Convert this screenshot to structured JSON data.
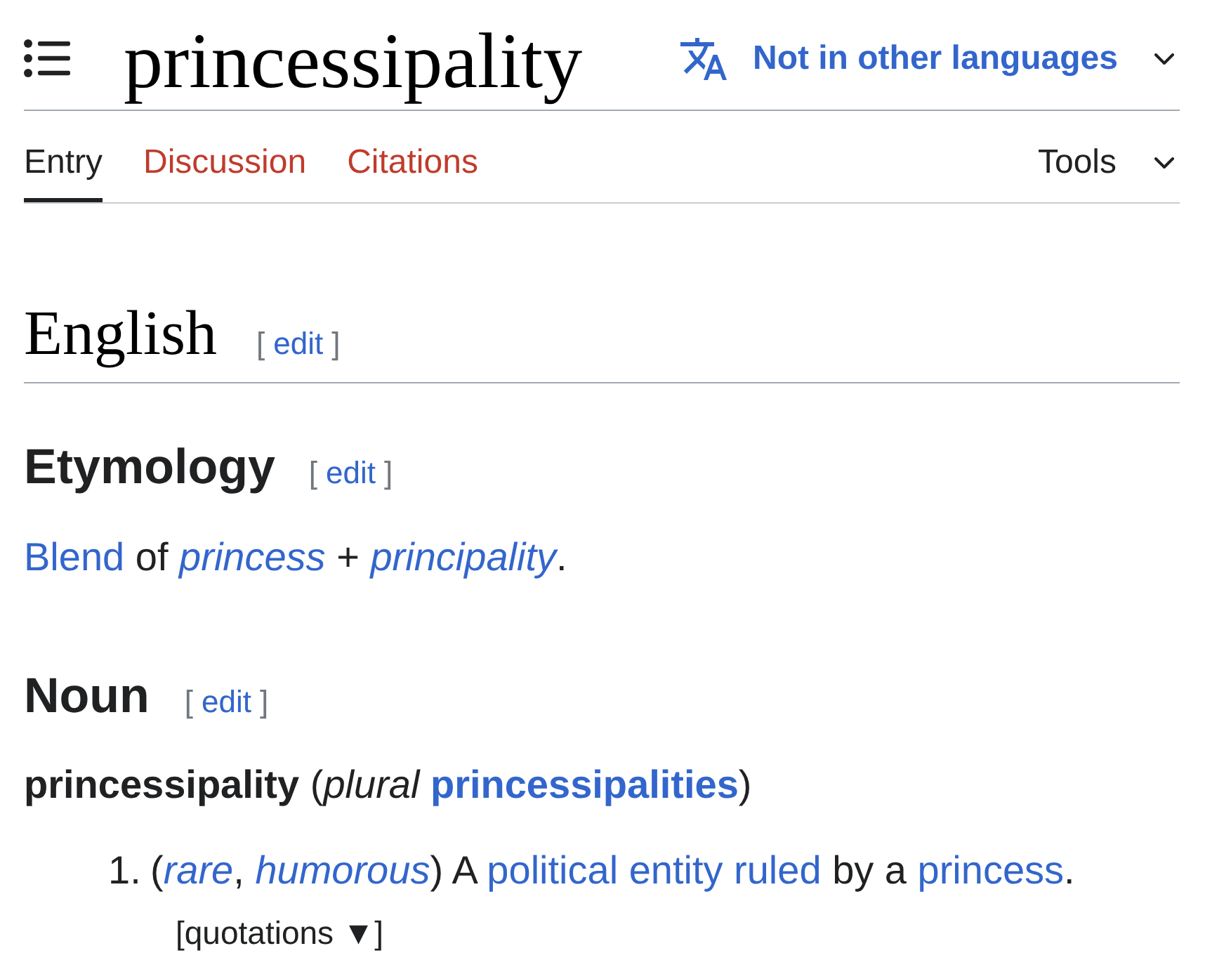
{
  "header": {
    "title": "princessipality",
    "language_button": {
      "label": "Not in other languages"
    }
  },
  "tabs": [
    {
      "label": "Entry",
      "selected": true,
      "page_exists": true
    },
    {
      "label": "Discussion",
      "selected": false,
      "page_exists": false
    },
    {
      "label": "Citations",
      "selected": false,
      "page_exists": false
    }
  ],
  "tools": {
    "label": "Tools"
  },
  "language_section": {
    "heading": "English",
    "edit": {
      "open": "[",
      "label": "edit",
      "close": "]"
    }
  },
  "etymology": {
    "heading": "Etymology",
    "edit": {
      "open": "[",
      "label": "edit",
      "close": "]"
    },
    "text": [
      {
        "kind": "link",
        "text": "Blend"
      },
      {
        "kind": "text",
        "text": " of "
      },
      {
        "kind": "link",
        "text": "*princess*"
      },
      {
        "kind": "text",
        "text": " + "
      },
      {
        "kind": "link",
        "text": "*principality*"
      },
      {
        "kind": "text",
        "text": "."
      }
    ]
  },
  "noun": {
    "heading": "Noun",
    "edit": {
      "open": "[",
      "label": "edit",
      "close": "]"
    },
    "headword_line": [
      {
        "kind": "text",
        "text": "**princessipality** (*plural* "
      },
      {
        "kind": "link",
        "text": "**princessipalities**"
      },
      {
        "kind": "text",
        "text": ")"
      }
    ],
    "senses": [
      {
        "number": "1.",
        "text": [
          {
            "kind": "text",
            "text": "("
          },
          {
            "kind": "link",
            "text": "*rare*"
          },
          {
            "kind": "text",
            "text": ", "
          },
          {
            "kind": "link",
            "text": "*humorous*"
          },
          {
            "kind": "text",
            "text": ") A "
          },
          {
            "kind": "link",
            "text": "political entity ruled"
          },
          {
            "kind": "text",
            "text": " by a "
          },
          {
            "kind": "link",
            "text": "princess"
          },
          {
            "kind": "text",
            "text": "."
          }
        ],
        "quotations_toggle": "[quotations ▼]"
      }
    ]
  }
}
